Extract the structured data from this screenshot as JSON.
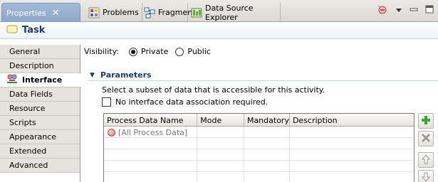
{
  "tabs": [
    {
      "label": "Properties",
      "icon": "properties-icon",
      "active": true
    },
    {
      "label": "Problems",
      "icon": "problems-icon",
      "active": false
    },
    {
      "label": "Fragments",
      "icon": "fragments-icon",
      "active": false
    },
    {
      "label": "Data Source Explorer",
      "icon": "data-source-explorer-icon",
      "active": false
    }
  ],
  "header": {
    "title": "Task"
  },
  "sidebar": {
    "items": [
      {
        "label": "General"
      },
      {
        "label": "Description"
      },
      {
        "label": "Interface"
      },
      {
        "label": "Data Fields"
      },
      {
        "label": "Resource"
      },
      {
        "label": "Scripts"
      },
      {
        "label": "Appearance"
      },
      {
        "label": "Extended"
      },
      {
        "label": "Advanced"
      }
    ]
  },
  "visibility": {
    "label": "Visibility:",
    "options": [
      {
        "label": "Private",
        "selected": true
      },
      {
        "label": "Public",
        "selected": false
      }
    ]
  },
  "parameters": {
    "title": "Parameters",
    "description": "Select a subset of data that is accessible for this activity.",
    "checkbox_label": "No interface data association required.",
    "checkbox_checked": false,
    "columns": [
      "Process Data Name",
      "Mode",
      "Mandatory",
      "Description"
    ],
    "rows": [
      {
        "name": "[All Process Data]",
        "mode": "",
        "mandatory": "",
        "description": ""
      }
    ]
  },
  "colors": {
    "active_tab": "#8ba5cc",
    "header_title": "#1f3c6e",
    "add_button": "#3aa832",
    "remove_button": "#9a9a9a"
  }
}
